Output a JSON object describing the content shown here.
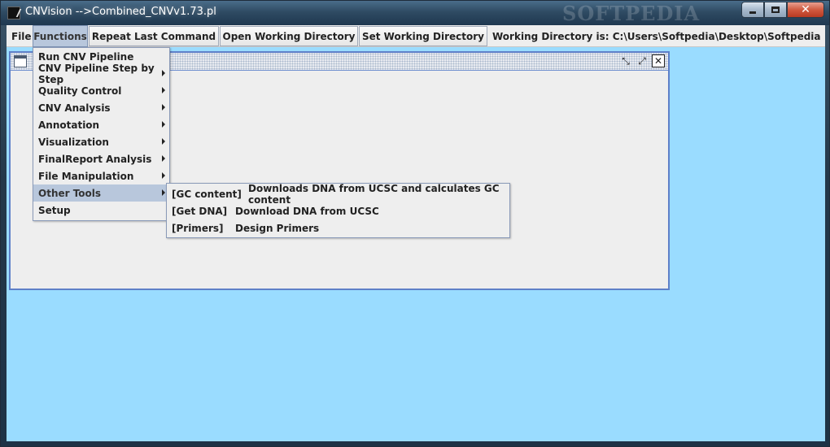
{
  "window": {
    "title": "CNVision -->Combined_CNVv1.73.pl",
    "watermark": "SOFTPEDIA"
  },
  "menubar": {
    "file_label": "File",
    "functions_label": "Functions",
    "repeat_label": "Repeat Last Command",
    "open_wd_label": "Open Working Directory",
    "set_wd_label": "Set Working Directory",
    "working_directory_text": "Working Directory is: C:\\Users\\Softpedia\\Desktop\\Softpedia"
  },
  "functions_menu": {
    "items": [
      {
        "label": "Run CNV Pipeline",
        "submenu": false
      },
      {
        "label": "CNV Pipeline Step by Step",
        "submenu": true
      },
      {
        "label": "Quality Control",
        "submenu": true
      },
      {
        "label": "CNV Analysis",
        "submenu": true
      },
      {
        "label": "Annotation",
        "submenu": true
      },
      {
        "label": "Visualization",
        "submenu": true
      },
      {
        "label": "FinalReport Analysis",
        "submenu": true
      },
      {
        "label": "File Manipulation",
        "submenu": true
      },
      {
        "label": "Other Tools",
        "submenu": true,
        "active": true
      },
      {
        "label": "Setup",
        "submenu": false
      }
    ]
  },
  "other_tools_submenu": {
    "items": [
      {
        "key": "[GC content]",
        "desc": "Downloads DNA from UCSC and calculates GC content"
      },
      {
        "key": "[Get DNA]",
        "desc": "Download DNA from UCSC"
      },
      {
        "key": "[Primers]",
        "desc": "Design Primers"
      }
    ]
  },
  "colors": {
    "desktop": "#9adcff",
    "menu_highlight": "#b8c7dc",
    "internal_frame_border": "#5e80c8"
  }
}
